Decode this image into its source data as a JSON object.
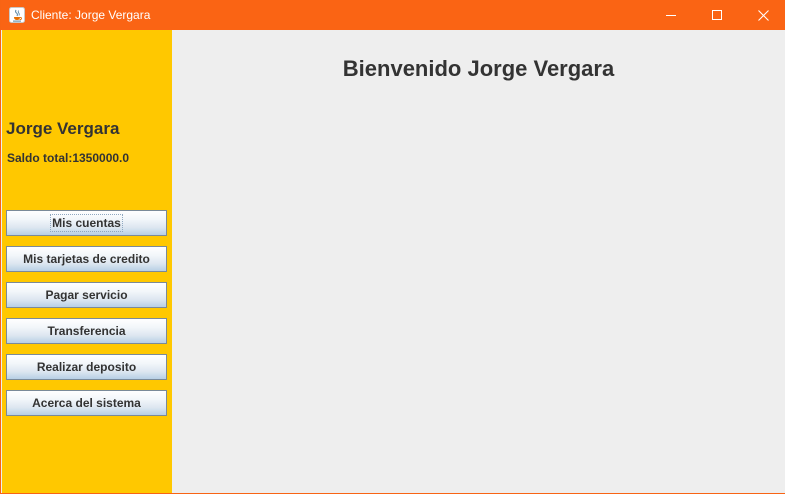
{
  "window": {
    "title": "Cliente: Jorge Vergara",
    "titlebar_color": "#fa6414"
  },
  "sidebar": {
    "background": "#ffc800",
    "client_name": "Jorge Vergara",
    "balance_text": "Saldo total:1350000.0",
    "buttons": [
      {
        "label": "Mis cuentas"
      },
      {
        "label": "Mis tarjetas de credito"
      },
      {
        "label": "Pagar servicio"
      },
      {
        "label": "Transferencia"
      },
      {
        "label": "Realizar deposito"
      },
      {
        "label": "Acerca del sistema"
      }
    ]
  },
  "main": {
    "welcome_text": "Bienvenido Jorge Vergara"
  }
}
